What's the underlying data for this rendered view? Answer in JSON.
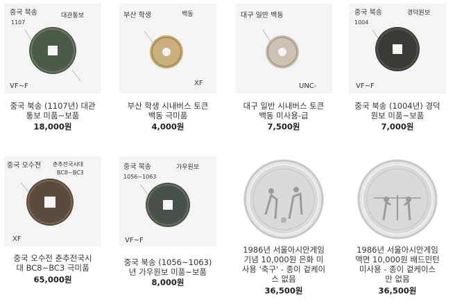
{
  "products": [
    {
      "title_lines": [
        "중국 북송 (1107년) 대관",
        "통보 미품~보품"
      ],
      "price": "18,000원",
      "notes": [
        "중국 북송",
        "1107",
        "대관통보",
        "VF~F"
      ]
    },
    {
      "title_lines": [
        "부산 학생 시내버스 토큰",
        "백동 극미품"
      ],
      "price": "4,000원",
      "notes": [
        "부산 학생",
        "백동",
        "XF"
      ]
    },
    {
      "title_lines": [
        "대구 일반 시내버스 토큰",
        "백동 미사용-급"
      ],
      "price": "7,500원",
      "notes": [
        "대구 일반 백동",
        "UNC-"
      ]
    },
    {
      "title_lines": [
        "중국 북송 (1004년) 경덕",
        "원보 미품~보품"
      ],
      "price": "7,000원",
      "notes": [
        "중국 북송",
        "1004",
        "경덕원보",
        "VF~F"
      ]
    },
    {
      "title_lines": [
        "중국 오수전 춘추전국시",
        "대 BC8~BC3 극미품"
      ],
      "price": "65,000원",
      "notes": [
        "중국 오수전",
        "춘추전국시대",
        "BC8~BC3",
        "XF"
      ]
    },
    {
      "title_lines": [
        "중국 북송 (1056~1063)",
        "년 가우원보 미품~보품"
      ],
      "price": "8,000원",
      "notes": [
        "중국 북송",
        "1056~1063",
        "가우원보",
        "VF~F"
      ]
    },
    {
      "title_lines": [
        "1986년 서울아시안게임",
        "기념 10,000원 은화 미",
        "사용 '축구' - 종이 겉케이",
        "스 없음"
      ],
      "price": "36,500원",
      "notes": []
    },
    {
      "title_lines": [
        "1986년 서울아시안게임",
        "액면 10,000원 배드민턴",
        "미사용 - 종이 겉케이스",
        "만 없음"
      ],
      "price": "36,500원",
      "notes": []
    }
  ],
  "colors": {
    "text": "#333333",
    "price": "#222222",
    "thumb_bg": "#f4f4f4",
    "ink": "#333333"
  }
}
